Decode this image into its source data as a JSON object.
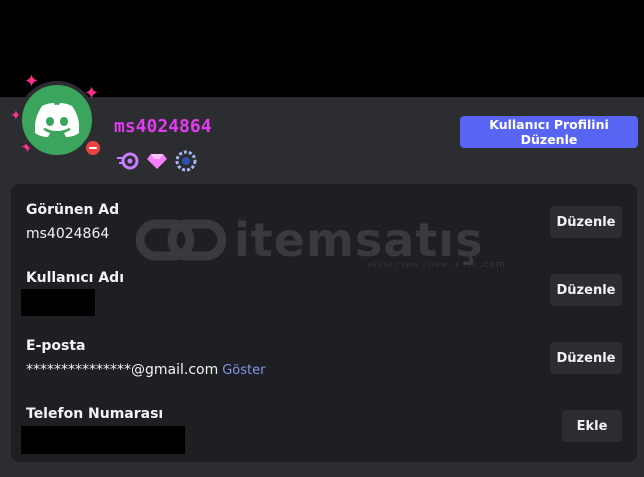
{
  "profile": {
    "username": "ms4024864",
    "edit_profile_label": "Kullanıcı Profilini Düzenle",
    "badges": [
      "nitro-icon",
      "gem-icon",
      "laurel-icon"
    ]
  },
  "fields": {
    "display_name": {
      "label": "Görünen Ad",
      "value": "ms4024864",
      "button": "Düzenle"
    },
    "username": {
      "label": "Kullanıcı Adı",
      "button": "Düzenle"
    },
    "email": {
      "label": "E-posta",
      "value": "***************@gmail.com",
      "reveal": "Göster",
      "button": "Düzenle"
    },
    "phone": {
      "label": "Telefon Numarası",
      "button": "Ekle"
    }
  },
  "watermark": {
    "text": "itemsatış",
    "subtext": "HESAP / SKIN / ITEM / E-PIN",
    "domain": ".com"
  },
  "colors": {
    "accent": "#5865f2",
    "username": "#e23cf0",
    "avatar_bg": "#3ba55d",
    "status_dnd": "#ed4245",
    "link": "#7e95e8"
  }
}
